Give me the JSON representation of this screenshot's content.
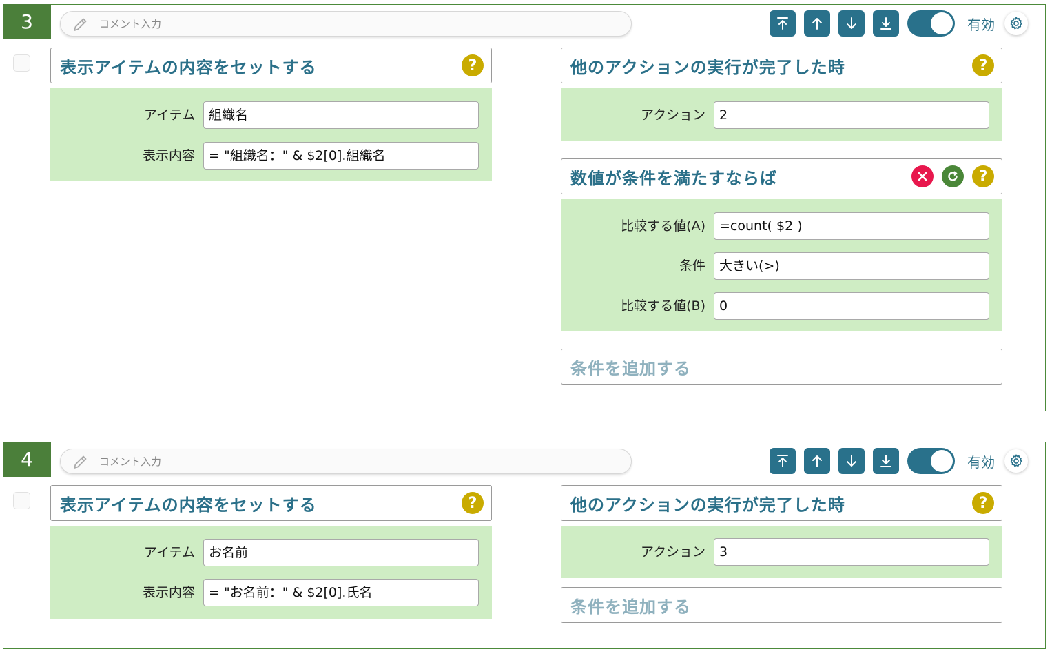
{
  "cards": [
    {
      "number": "3",
      "comment_placeholder": "コメント入力",
      "valid_label": "有効",
      "action": {
        "title": "表示アイテムの内容をセットする",
        "fields": [
          {
            "label": "アイテム",
            "value": "組織名"
          },
          {
            "label": "表示内容",
            "value": "= \"組織名：\" & $2[0].組織名"
          }
        ]
      },
      "trigger": {
        "title": "他のアクションの実行が完了した時",
        "fields": [
          {
            "label": "アクション",
            "value": "2"
          }
        ]
      },
      "condition": {
        "title": "数値が条件を満たすならば",
        "fields": [
          {
            "label": "比較する値(A)",
            "value": "=count( $2 )"
          },
          {
            "label": "条件",
            "value": "大きい(>)"
          },
          {
            "label": "比較する値(B)",
            "value": "0"
          }
        ]
      },
      "add_condition_label": "条件を追加する"
    },
    {
      "number": "4",
      "comment_placeholder": "コメント入力",
      "valid_label": "有効",
      "action": {
        "title": "表示アイテムの内容をセットする",
        "fields": [
          {
            "label": "アイテム",
            "value": "お名前"
          },
          {
            "label": "表示内容",
            "value": "= \"お名前：\" & $2[0].氏名"
          }
        ]
      },
      "trigger": {
        "title": "他のアクションの実行が完了した時",
        "fields": [
          {
            "label": "アクション",
            "value": "3"
          }
        ]
      },
      "add_condition_label": "条件を追加する"
    }
  ],
  "icons": {
    "move_top": "move-to-top-icon",
    "move_up": "arrow-up-icon",
    "move_down": "arrow-down-icon",
    "move_bottom": "move-to-bottom-icon",
    "help": "question-icon",
    "delete": "close-icon",
    "refresh": "refresh-icon",
    "settings": "gear-icon",
    "comment": "pencil-icon"
  },
  "help_glyph": "?",
  "toggle_enabled": true,
  "colors": {
    "card_border": "#4c8a3a",
    "number_bg": "#4b7f3a",
    "accent": "#29718b",
    "panel_bg": "#cfedc4",
    "help": "#c9ab00",
    "delete": "#e8174d",
    "refresh": "#4a8738"
  }
}
